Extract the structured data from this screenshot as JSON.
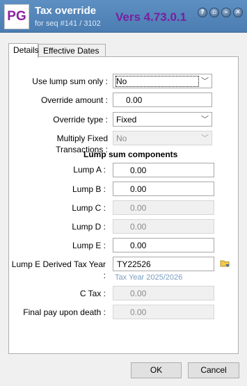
{
  "titlebar": {
    "logo": "PG",
    "title": "Tax override",
    "subtitle": "for seq #141 / 3102",
    "version": "Vers 4.73.0.1",
    "buttons": [
      {
        "icon": "help-icon",
        "glyph": "?"
      },
      {
        "icon": "restore-icon",
        "glyph": "▫"
      },
      {
        "icon": "minimize-icon",
        "glyph": "–"
      },
      {
        "icon": "close-icon",
        "glyph": "✕"
      }
    ]
  },
  "tabs": [
    {
      "label": "Details",
      "active": true
    },
    {
      "label": "Effective Dates",
      "active": false
    }
  ],
  "form": {
    "use_lump_sum_only": {
      "label": "Use lump sum only :",
      "value": "No"
    },
    "override_amount": {
      "label": "Override amount :",
      "value": "0.00"
    },
    "override_type": {
      "label": "Override type :",
      "value": "Fixed"
    },
    "multiply_fixed": {
      "label": "Multiply Fixed Transactions :",
      "value": "No"
    },
    "section_title": "Lump sum components",
    "lump_a": {
      "label": "Lump A :",
      "value": "0.00"
    },
    "lump_b": {
      "label": "Lump B :",
      "value": "0.00"
    },
    "lump_c": {
      "label": "Lump C :",
      "value": "0.00"
    },
    "lump_d": {
      "label": "Lump D :",
      "value": "0.00"
    },
    "lump_e": {
      "label": "Lump E :",
      "value": "0.00"
    },
    "lump_e_tax_year": {
      "label": "Lump E Derived Tax Year :",
      "value": "TY22526",
      "helper": "Tax Year 2025/2026"
    },
    "c_tax": {
      "label": "C Tax :",
      "value": "0.00"
    },
    "final_pay": {
      "label": "Final pay upon death :",
      "value": "0.00"
    }
  },
  "footer": {
    "ok_label": "OK",
    "cancel_label": "Cancel"
  },
  "colors": {
    "titlebar": "#5d8fc2",
    "logo_text": "#8b1fa0",
    "version": "#7a1fa0",
    "helper": "#7a9cc0"
  }
}
